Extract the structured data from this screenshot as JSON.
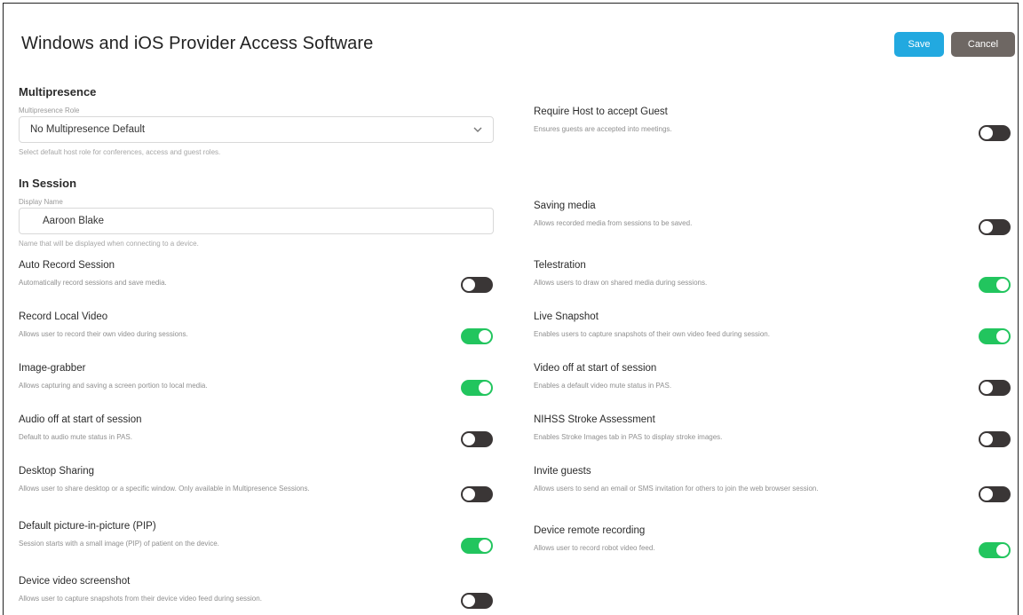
{
  "header": {
    "title": "Windows and iOS Provider Access Software",
    "save_label": "Save",
    "cancel_label": "Cancel"
  },
  "multipresence": {
    "section_title": "Multipresence",
    "role_label": "Multipresence Role",
    "role_value": "No Multipresence Default",
    "role_help": "Select default host role for conferences, access and guest roles."
  },
  "in_session": {
    "section_title": "In Session",
    "display_name_label": "Display Name",
    "display_name_value": "Aaroon Blake",
    "display_name_help": "Name that will be displayed when connecting to a device."
  },
  "left_settings": [
    {
      "title": "Auto Record Session",
      "desc": "Automatically record sessions and save media.",
      "enabled": false
    },
    {
      "title": "Record Local Video",
      "desc": "Allows user to record their own video during sessions.",
      "enabled": true
    },
    {
      "title": "Image-grabber",
      "desc": "Allows capturing and saving a screen portion to local media.",
      "enabled": true
    },
    {
      "title": "Audio off at start of session",
      "desc": "Default to audio mute status in PAS.",
      "enabled": false
    },
    {
      "title": "Desktop Sharing",
      "desc": "Allows user to share desktop or a specific window. Only available in Multipresence Sessions.",
      "enabled": false
    },
    {
      "title": "Default picture-in-picture (PIP)",
      "desc": "Session starts with a small image (PIP) of patient on the device.",
      "enabled": true
    },
    {
      "title": "Device video screenshot",
      "desc": "Allows user to capture snapshots from their device video feed during session.",
      "enabled": false
    }
  ],
  "right_settings": [
    {
      "title": "Require Host to accept Guest",
      "desc": "Ensures guests are accepted into meetings.",
      "enabled": false
    },
    {
      "title": "Saving media",
      "desc": "Allows recorded media from sessions to be saved.",
      "enabled": false
    },
    {
      "title": "Telestration",
      "desc": "Allows users to draw on shared media during sessions.",
      "enabled": true
    },
    {
      "title": "Live Snapshot",
      "desc": "Enables users to capture snapshots of their own video feed during session.",
      "enabled": true
    },
    {
      "title": "Video off at start of session",
      "desc": "Enables a default video mute status in PAS.",
      "enabled": false
    },
    {
      "title": "NIHSS Stroke Assessment",
      "desc": "Enables Stroke Images tab in PAS to display stroke images.",
      "enabled": false
    },
    {
      "title": "Invite guests",
      "desc": "Allows users to send an email or SMS invitation for others to join the web browser session.",
      "enabled": false
    },
    {
      "title": "Device remote recording",
      "desc": "Allows user to record robot video feed.",
      "enabled": true
    }
  ],
  "colors": {
    "primary": "#22a9e0",
    "cancel": "#6e6763",
    "toggle_on": "#22c55e",
    "toggle_off": "#3a3636"
  },
  "icons": {
    "dropdown": "chevron-down-icon"
  }
}
